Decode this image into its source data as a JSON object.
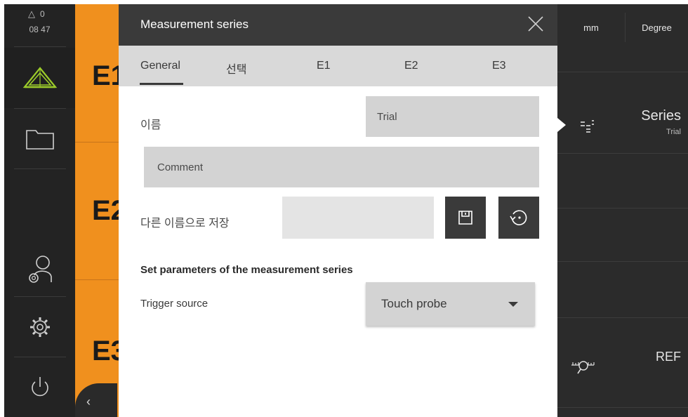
{
  "status": {
    "alert_count": "0",
    "time": "08 47"
  },
  "list": {
    "labels": [
      "E1",
      "E2",
      "E3"
    ]
  },
  "right_panel": {
    "unit_length": "mm",
    "unit_angle": "Degree",
    "series_title": "Series",
    "series_sub": "Trial",
    "ref_label": "REF"
  },
  "dialog": {
    "title": "Measurement series",
    "tabs": [
      "General",
      "선택",
      "E1",
      "E2",
      "E3"
    ],
    "active_tab": "General",
    "name_label": "이름",
    "name_value": "Trial",
    "comment_placeholder": "Comment",
    "save_as_label": "다른 이름으로 저장",
    "save_as_value": "",
    "section_title": "Set parameters of the measurement series",
    "trigger_label": "Trigger source",
    "trigger_value": "Touch probe"
  },
  "colors": {
    "accent_orange": "#f0901e",
    "logo_green": "#9ccc2a",
    "dark": "#3a3a3a"
  },
  "icons": [
    "triangle-alert-icon",
    "measure-logo-icon",
    "folder-icon",
    "user-settings-icon",
    "gear-icon",
    "power-icon",
    "chevron-left-icon",
    "close-icon",
    "save-icon",
    "reset-icon",
    "series-icon",
    "reference-icon",
    "dropdown-caret-icon"
  ]
}
